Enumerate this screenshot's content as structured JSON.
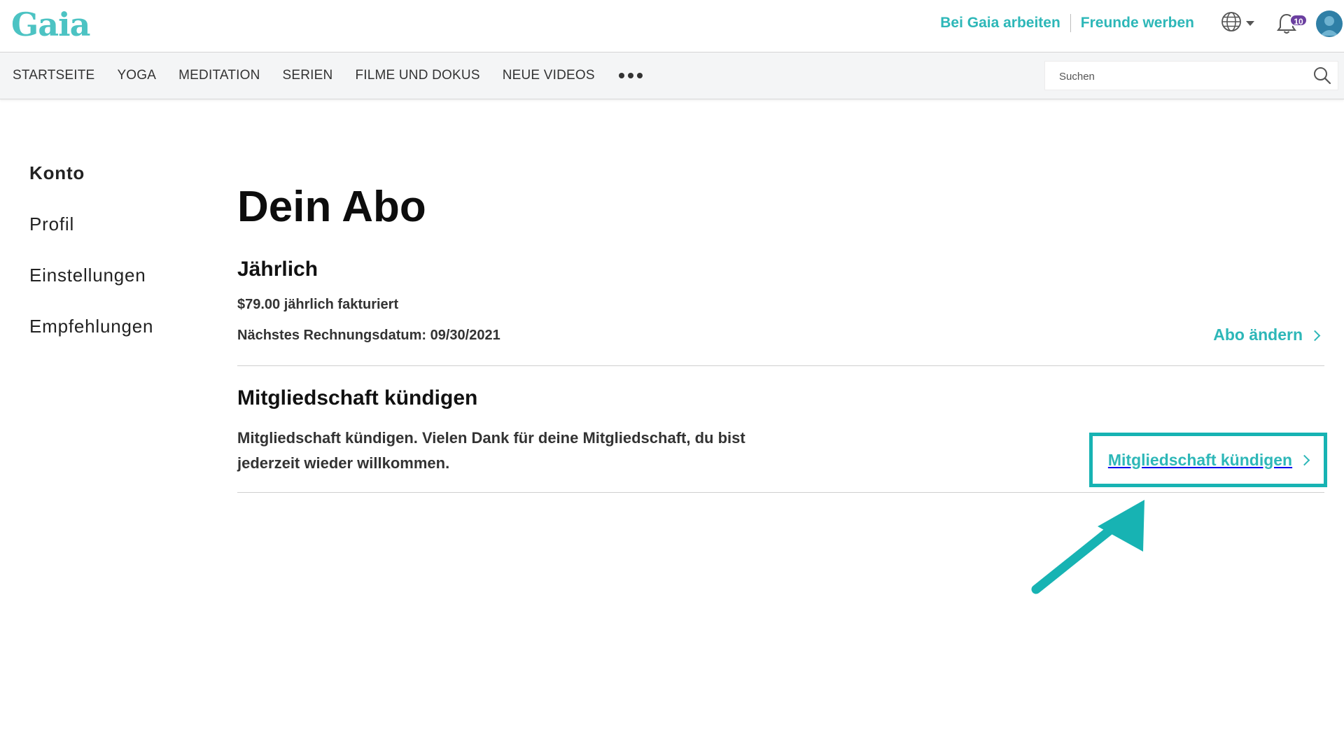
{
  "header": {
    "logo": "Gaia",
    "links": [
      "Bei Gaia arbeiten",
      "Freunde werben"
    ],
    "notifications_count": "10",
    "icons": [
      "globe-icon",
      "chevron-down-icon",
      "bell-icon",
      "avatar"
    ]
  },
  "nav": {
    "items": [
      "STARTSEITE",
      "YOGA",
      "MEDITATION",
      "SERIEN",
      "FILME UND DOKUS",
      "NEUE VIDEOS"
    ],
    "more_icon": "more-dots-icon",
    "search_placeholder": "Suchen"
  },
  "sidebar": {
    "items": [
      "Konto",
      "Profil",
      "Einstellungen",
      "Empfehlungen"
    ],
    "active_index": 0
  },
  "main": {
    "title": "Dein Abo",
    "plan": {
      "name": "Jährlich",
      "price": "$79.00 jährlich fakturiert",
      "next_billing": "Nächstes Rechnungsdatum: 09/30/2021",
      "change_link": "Abo ändern"
    },
    "cancel": {
      "title": "Mitgliedschaft kündigen",
      "description": "Mitgliedschaft kündigen. Vielen Dank für deine Mitgliedschaft, du bist jederzeit wieder willkommen.",
      "link": "Mitgliedschaft kündigen"
    }
  },
  "colors": {
    "accent": "#2db7b8",
    "highlight_box": "#17b3b3",
    "badge": "#6b3fa0"
  }
}
